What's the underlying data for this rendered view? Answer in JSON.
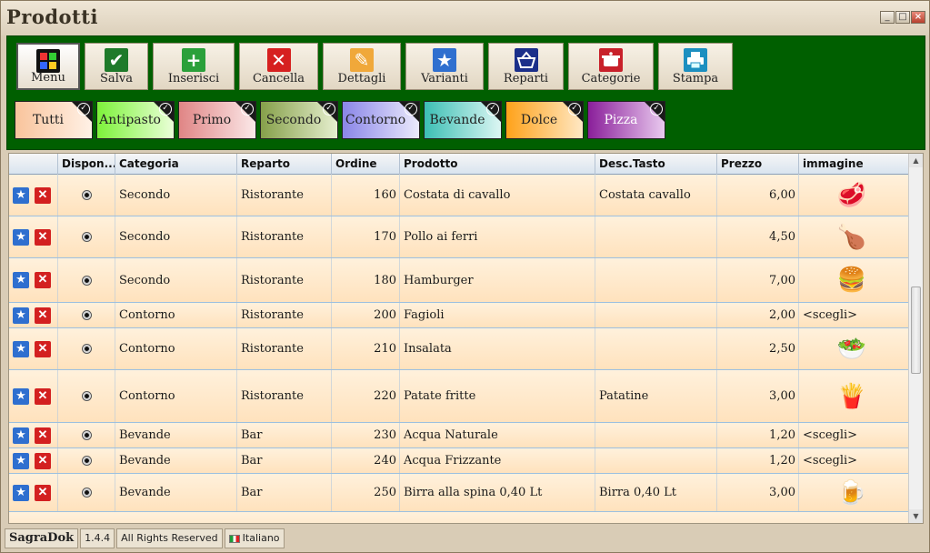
{
  "window": {
    "title": "Prodotti"
  },
  "toolbar": {
    "buttons": [
      {
        "label": "Menu",
        "icon": "menu-grid-icon"
      },
      {
        "label": "Salva",
        "icon": "check-icon"
      },
      {
        "label": "Inserisci",
        "icon": "plus-icon"
      },
      {
        "label": "Cancella",
        "icon": "x-icon"
      },
      {
        "label": "Dettagli",
        "icon": "pencil-icon"
      },
      {
        "label": "Varianti",
        "icon": "star-icon"
      },
      {
        "label": "Reparti",
        "icon": "basket-icon"
      },
      {
        "label": "Categorie",
        "icon": "pot-icon"
      },
      {
        "label": "Stampa",
        "icon": "printer-icon"
      }
    ]
  },
  "categories": [
    {
      "label": "Tutti",
      "color": "#f9c49c"
    },
    {
      "label": "Antipasto",
      "color": "#7df23a"
    },
    {
      "label": "Primo",
      "color": "#e08585"
    },
    {
      "label": "Secondo",
      "color": "#86a04a"
    },
    {
      "label": "Contorno",
      "color": "#8a86e8"
    },
    {
      "label": "Bevande",
      "color": "#3cbfb4"
    },
    {
      "label": "Dolce",
      "color": "#ffa21a"
    },
    {
      "label": "Pizza",
      "color": "#8a1f9a"
    }
  ],
  "grid": {
    "columns": [
      "",
      "Dispon...",
      "Categoria",
      "Reparto",
      "Ordine",
      "Prodotto",
      "Desc.Tasto",
      "Prezzo",
      "immagine"
    ],
    "rows": [
      {
        "categoria": "Secondo",
        "reparto": "Ristorante",
        "ordine": "160",
        "prodotto": "Costata di cavallo",
        "desc": "Costata cavallo",
        "prezzo": "6,00",
        "immagine": "",
        "img_icon": "meat-icon"
      },
      {
        "categoria": "Secondo",
        "reparto": "Ristorante",
        "ordine": "170",
        "prodotto": "Pollo ai ferri",
        "desc": "",
        "prezzo": "4,50",
        "immagine": "",
        "img_icon": "chicken-icon"
      },
      {
        "categoria": "Secondo",
        "reparto": "Ristorante",
        "ordine": "180",
        "prodotto": "Hamburger",
        "desc": "",
        "prezzo": "7,00",
        "immagine": "",
        "img_icon": "hamburger-icon"
      },
      {
        "categoria": "Contorno",
        "reparto": "Ristorante",
        "ordine": "200",
        "prodotto": "Fagioli",
        "desc": "",
        "prezzo": "2,00",
        "immagine": "<scegli>",
        "img_icon": ""
      },
      {
        "categoria": "Contorno",
        "reparto": "Ristorante",
        "ordine": "210",
        "prodotto": "Insalata",
        "desc": "",
        "prezzo": "2,50",
        "immagine": "",
        "img_icon": "salad-icon"
      },
      {
        "categoria": "Contorno",
        "reparto": "Ristorante",
        "ordine": "220",
        "prodotto": "Patate fritte",
        "desc": "Patatine",
        "prezzo": "3,00",
        "immagine": "",
        "img_icon": "fries-icon"
      },
      {
        "categoria": "Bevande",
        "reparto": "Bar",
        "ordine": "230",
        "prodotto": "Acqua Naturale",
        "desc": "",
        "prezzo": "1,20",
        "immagine": "<scegli>",
        "img_icon": ""
      },
      {
        "categoria": "Bevande",
        "reparto": "Bar",
        "ordine": "240",
        "prodotto": "Acqua Frizzante",
        "desc": "",
        "prezzo": "1,20",
        "immagine": "<scegli>",
        "img_icon": ""
      },
      {
        "categoria": "Bevande",
        "reparto": "Bar",
        "ordine": "250",
        "prodotto": "Birra alla spina 0,40 Lt",
        "desc": "Birra 0,40 Lt",
        "prezzo": "3,00",
        "immagine": "",
        "img_icon": "beer-icon"
      }
    ]
  },
  "status": {
    "app": "SagraDok",
    "version": "1.4.4",
    "rights": "All Rights Reserved",
    "language": "Italiano"
  }
}
